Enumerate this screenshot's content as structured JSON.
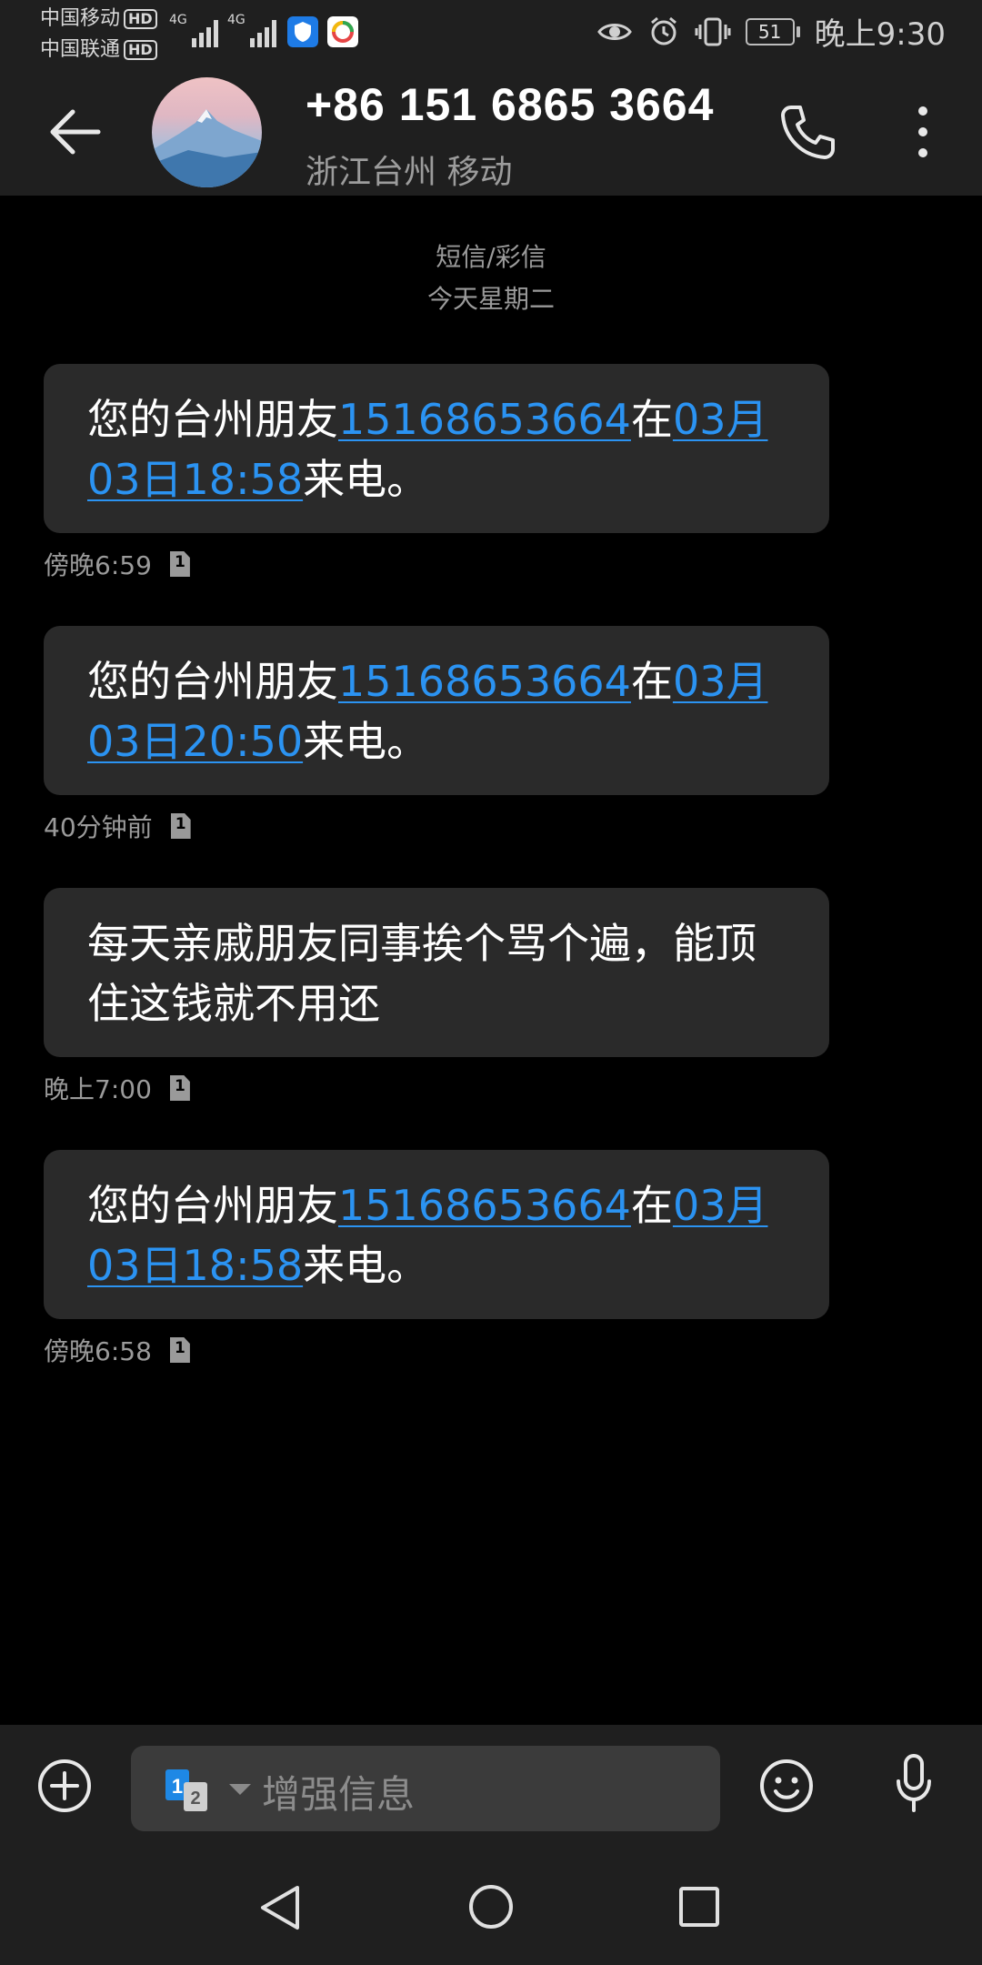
{
  "status_bar": {
    "carrier_1": "中国移动",
    "carrier_2": "中国联通",
    "hd_label": "HD",
    "network_1": "4G",
    "network_2": "4G",
    "battery": "51",
    "time": "晚上9:30"
  },
  "header": {
    "phone_number": "+86 151 6865 3664",
    "location": "浙江台州 移动"
  },
  "thread": {
    "type_label": "短信/彩信",
    "date_label": "今天星期二"
  },
  "messages": [
    {
      "segments": [
        {
          "text": "您的台州朋友",
          "link": false
        },
        {
          "text": "15168653664",
          "link": true
        },
        {
          "text": "在",
          "link": false
        },
        {
          "text": "03月03日18:58",
          "link": true
        },
        {
          "text": "来电。",
          "link": false
        }
      ],
      "time": "傍晚6:59",
      "sim": "1"
    },
    {
      "segments": [
        {
          "text": "您的台州朋友",
          "link": false
        },
        {
          "text": "15168653664",
          "link": true
        },
        {
          "text": "在",
          "link": false
        },
        {
          "text": "03月03日20:50",
          "link": true
        },
        {
          "text": "来电。",
          "link": false
        }
      ],
      "time": "40分钟前",
      "sim": "1"
    },
    {
      "segments": [
        {
          "text": "每天亲戚朋友同事挨个骂个遍，能顶住这钱就不用还",
          "link": false
        }
      ],
      "time": "晚上7:00",
      "sim": "1"
    },
    {
      "segments": [
        {
          "text": "您的台州朋友",
          "link": false
        },
        {
          "text": "15168653664",
          "link": true
        },
        {
          "text": "在",
          "link": false
        },
        {
          "text": "03月03日18:58",
          "link": true
        },
        {
          "text": "来电。",
          "link": false
        }
      ],
      "time": "傍晚6:58",
      "sim": "1"
    }
  ],
  "composer": {
    "placeholder": "增强信息",
    "sim_1": "1",
    "sim_2": "2"
  },
  "colors": {
    "link": "#2b93f2",
    "bubble": "#2a2a2a",
    "bar": "#1f1f1f",
    "background": "#000000"
  },
  "icons": {
    "back": "arrow-left-icon",
    "call": "phone-icon",
    "more": "more-vertical-icon",
    "add": "plus-circle-icon",
    "emoji": "smiley-icon",
    "mic": "microphone-icon",
    "nav_back": "triangle-back-icon",
    "nav_home": "circle-home-icon",
    "nav_recent": "square-recent-icon"
  }
}
